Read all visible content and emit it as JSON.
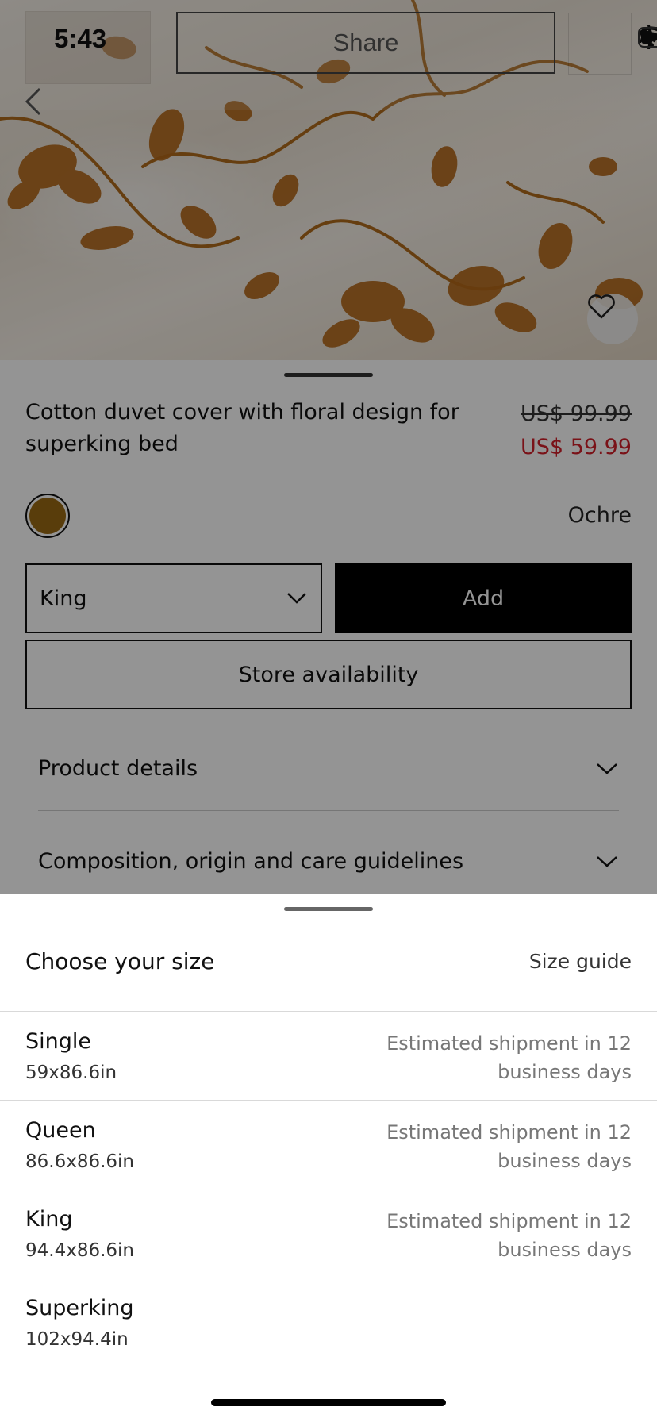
{
  "status_bar": {
    "time": "5:43"
  },
  "header": {
    "share_label": "Share"
  },
  "product": {
    "title": "Cotton duvet cover with floral design for superking bed",
    "price_old": "US$ 99.99",
    "price_new": "US$ 59.99",
    "color_name": "Ochre",
    "color_hex": "#9a6a14",
    "selected_size": "King",
    "add_label": "Add",
    "store_label": "Store availability",
    "accordions": [
      {
        "label": "Product details"
      },
      {
        "label": "Composition, origin and care guidelines"
      }
    ]
  },
  "size_sheet": {
    "title": "Choose your size",
    "guide_label": "Size guide",
    "sizes": [
      {
        "name": "Single",
        "dims": "59x86.6in",
        "shipment": "Estimated shipment in 12 business days"
      },
      {
        "name": "Queen",
        "dims": "86.6x86.6in",
        "shipment": "Estimated shipment in 12 business days"
      },
      {
        "name": "King",
        "dims": "94.4x86.6in",
        "shipment": "Estimated shipment in 12 business days"
      },
      {
        "name": "Superking",
        "dims": "102x94.4in",
        "shipment": ""
      }
    ]
  },
  "icons": {
    "back": "chevron-left-icon",
    "favorite": "heart-icon",
    "dropdown": "chevron-down-icon",
    "airplane": "airplane-icon",
    "wifi": "wifi-icon",
    "battery": "battery-icon"
  }
}
